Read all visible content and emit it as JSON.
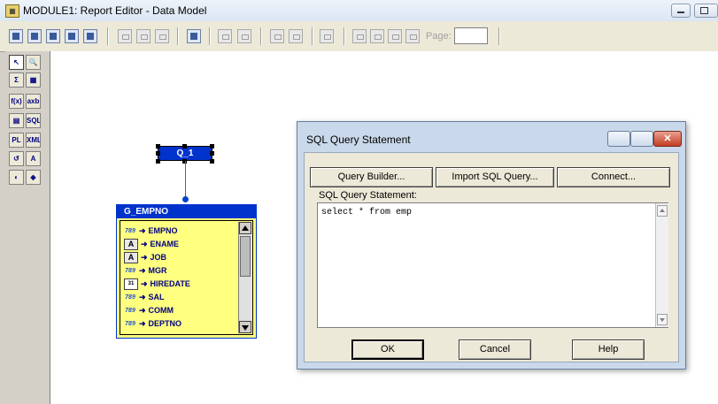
{
  "window": {
    "title": "MODULE1: Report Editor - Data Model",
    "app_icon": "report-builder-icon"
  },
  "toolbar": {
    "page_label": "Page:",
    "page_value": ""
  },
  "palette": {
    "tools": [
      {
        "name": "select-tool",
        "glyph": "↖"
      },
      {
        "name": "magnify-tool",
        "glyph": "🔍"
      },
      {
        "name": "summary-column-tool",
        "glyph": "Σ"
      },
      {
        "name": "database-column-tool",
        "glyph": "▦"
      },
      {
        "name": "formula-column-tool",
        "glyph": "f(x)"
      },
      {
        "name": "placeholder-column-tool",
        "glyph": "axb"
      },
      {
        "name": "cross-product-tool",
        "glyph": "▤"
      },
      {
        "name": "sql-query-tool",
        "glyph": "SQL"
      },
      {
        "name": "plsql-tool",
        "glyph": "PL"
      },
      {
        "name": "xml-query-tool",
        "glyph": "XML"
      },
      {
        "name": "data-link-tool",
        "glyph": "↺"
      },
      {
        "name": "text-query-tool",
        "glyph": "A"
      },
      {
        "name": "express-query-tool",
        "glyph": "◐"
      },
      {
        "name": "ref-cursor-tool",
        "glyph": "◈"
      }
    ]
  },
  "query": {
    "name": "Q_1"
  },
  "group": {
    "name": "G_EMPNO",
    "columns": [
      {
        "name": "EMPNO",
        "type": "789"
      },
      {
        "name": "ENAME",
        "type": "A"
      },
      {
        "name": "JOB",
        "type": "A"
      },
      {
        "name": "MGR",
        "type": "789"
      },
      {
        "name": "HIREDATE",
        "type": "31"
      },
      {
        "name": "SAL",
        "type": "789"
      },
      {
        "name": "COMM",
        "type": "789"
      },
      {
        "name": "DEPTNO",
        "type": "789"
      }
    ]
  },
  "dialog": {
    "title": "SQL Query Statement",
    "query_builder_label": "Query Builder...",
    "import_sql_label": "Import SQL Query...",
    "connect_label": "Connect...",
    "statement_label": "SQL Query Statement:",
    "statement_value": "select * from emp",
    "ok_label": "OK",
    "cancel_label": "Cancel",
    "help_label": "Help"
  },
  "colors": {
    "query_fill": "#0033cc",
    "group_fill": "#ffff80",
    "dialog_frame": "#c9d8ea"
  }
}
